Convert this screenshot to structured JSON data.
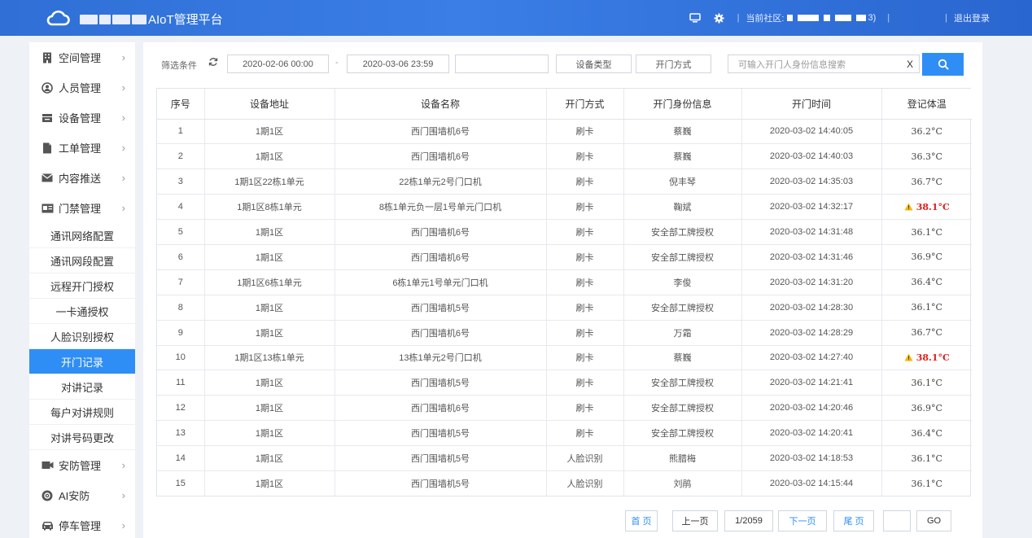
{
  "header": {
    "title_suffix": "AIoT管理平台",
    "community_label": "当前社区:",
    "community_suffix": "3)",
    "logout": "退出登录"
  },
  "sidebar": {
    "menus_top": [
      {
        "name": "space",
        "label": "空间管理",
        "icon": "building-icon"
      },
      {
        "name": "personnel",
        "label": "人员管理",
        "icon": "user-icon"
      },
      {
        "name": "device",
        "label": "设备管理",
        "icon": "device-icon"
      },
      {
        "name": "workorder",
        "label": "工单管理",
        "icon": "document-icon"
      },
      {
        "name": "content",
        "label": "内容推送",
        "icon": "mail-icon"
      },
      {
        "name": "access",
        "label": "门禁管理",
        "icon": "id-card-icon"
      }
    ],
    "sub_items": [
      {
        "label": "通讯网络配置",
        "active": false
      },
      {
        "label": "通讯网段配置",
        "active": false
      },
      {
        "label": "远程开门授权",
        "active": false
      },
      {
        "label": "一卡通授权",
        "active": false
      },
      {
        "label": "人脸识别授权",
        "active": false
      },
      {
        "label": "开门记录",
        "active": true
      },
      {
        "label": "对讲记录",
        "active": false
      },
      {
        "label": "每户对讲规则",
        "active": false
      },
      {
        "label": "对讲号码更改",
        "active": false
      }
    ],
    "menus_bottom": [
      {
        "name": "security",
        "label": "安防管理",
        "icon": "camera-icon"
      },
      {
        "name": "ai-security",
        "label": "AI安防",
        "icon": "ai-icon"
      },
      {
        "name": "parking",
        "label": "停车管理",
        "icon": "car-icon"
      }
    ]
  },
  "filter": {
    "label": "筛选条件",
    "start_time": "2020-02-06 00:00",
    "separator": "-",
    "end_time": "2020-03-06 23:59",
    "device_type": "设备类型",
    "open_method": "开门方式",
    "search_placeholder": "可输入开门人身份信息搜索",
    "clear": "X"
  },
  "table": {
    "columns": [
      "序号",
      "设备地址",
      "设备名称",
      "开门方式",
      "开门身份信息",
      "开门时间",
      "登记体温"
    ],
    "rows": [
      {
        "no": "1",
        "address": "1期1区",
        "device": "西门围墙机6号",
        "method": "刷卡",
        "identity": "蔡巍",
        "time": "2020-03-02 14:40:05",
        "temp": "36.2°C",
        "warn": false
      },
      {
        "no": "2",
        "address": "1期1区",
        "device": "西门围墙机6号",
        "method": "刷卡",
        "identity": "蔡巍",
        "time": "2020-03-02 14:40:03",
        "temp": "36.3°C",
        "warn": false
      },
      {
        "no": "3",
        "address": "1期1区22栋1单元",
        "device": "22栋1单元2号门口机",
        "method": "刷卡",
        "identity": "倪丰琴",
        "time": "2020-03-02 14:35:03",
        "temp": "36.7°C",
        "warn": false
      },
      {
        "no": "4",
        "address": "1期1区8栋1单元",
        "device": "8栋1单元负一层1号单元门口机",
        "method": "刷卡",
        "identity": "鞠斌",
        "time": "2020-03-02 14:32:17",
        "temp": "38.1°C",
        "warn": true
      },
      {
        "no": "5",
        "address": "1期1区",
        "device": "西门围墙机6号",
        "method": "刷卡",
        "identity": "安全部工牌授权",
        "time": "2020-03-02 14:31:48",
        "temp": "36.1°C",
        "warn": false
      },
      {
        "no": "6",
        "address": "1期1区",
        "device": "西门围墙机6号",
        "method": "刷卡",
        "identity": "安全部工牌授权",
        "time": "2020-03-02 14:31:46",
        "temp": "36.9°C",
        "warn": false
      },
      {
        "no": "7",
        "address": "1期1区6栋1单元",
        "device": "6栋1单元1号单元门口机",
        "method": "刷卡",
        "identity": "李俊",
        "time": "2020-03-02 14:31:20",
        "temp": "36.4°C",
        "warn": false
      },
      {
        "no": "8",
        "address": "1期1区",
        "device": "西门围墙机5号",
        "method": "刷卡",
        "identity": "安全部工牌授权",
        "time": "2020-03-02 14:28:30",
        "temp": "36.1°C",
        "warn": false
      },
      {
        "no": "9",
        "address": "1期1区",
        "device": "西门围墙机6号",
        "method": "刷卡",
        "identity": "万霜",
        "time": "2020-03-02 14:28:29",
        "temp": "36.7°C",
        "warn": false
      },
      {
        "no": "10",
        "address": "1期1区13栋1单元",
        "device": "13栋1单元2号门口机",
        "method": "刷卡",
        "identity": "蔡巍",
        "time": "2020-03-02 14:27:40",
        "temp": "38.1°C",
        "warn": true
      },
      {
        "no": "11",
        "address": "1期1区",
        "device": "西门围墙机5号",
        "method": "刷卡",
        "identity": "安全部工牌授权",
        "time": "2020-03-02 14:21:41",
        "temp": "36.1°C",
        "warn": false
      },
      {
        "no": "12",
        "address": "1期1区",
        "device": "西门围墙机6号",
        "method": "刷卡",
        "identity": "安全部工牌授权",
        "time": "2020-03-02 14:20:46",
        "temp": "36.9°C",
        "warn": false
      },
      {
        "no": "13",
        "address": "1期1区",
        "device": "西门围墙机5号",
        "method": "刷卡",
        "identity": "安全部工牌授权",
        "time": "2020-03-02 14:20:41",
        "temp": "36.4°C",
        "warn": false
      },
      {
        "no": "14",
        "address": "1期1区",
        "device": "西门围墙机5号",
        "method": "人脸识别",
        "identity": "熊腊梅",
        "time": "2020-03-02 14:18:53",
        "temp": "36.1°C",
        "warn": false
      },
      {
        "no": "15",
        "address": "1期1区",
        "device": "西门围墙机5号",
        "method": "人脸识别",
        "identity": "刘鹃",
        "time": "2020-03-02 14:15:44",
        "temp": "36.1°C",
        "warn": false
      }
    ]
  },
  "pagination": {
    "first": "首 页",
    "prev": "上一页",
    "page_info": "1/2059",
    "next": "下一页",
    "last": "尾 页",
    "goto_value": "",
    "go": "GO"
  },
  "colors": {
    "header": "#2f6fd6",
    "accent": "#2f8ef5",
    "warning": "#e0201b"
  }
}
